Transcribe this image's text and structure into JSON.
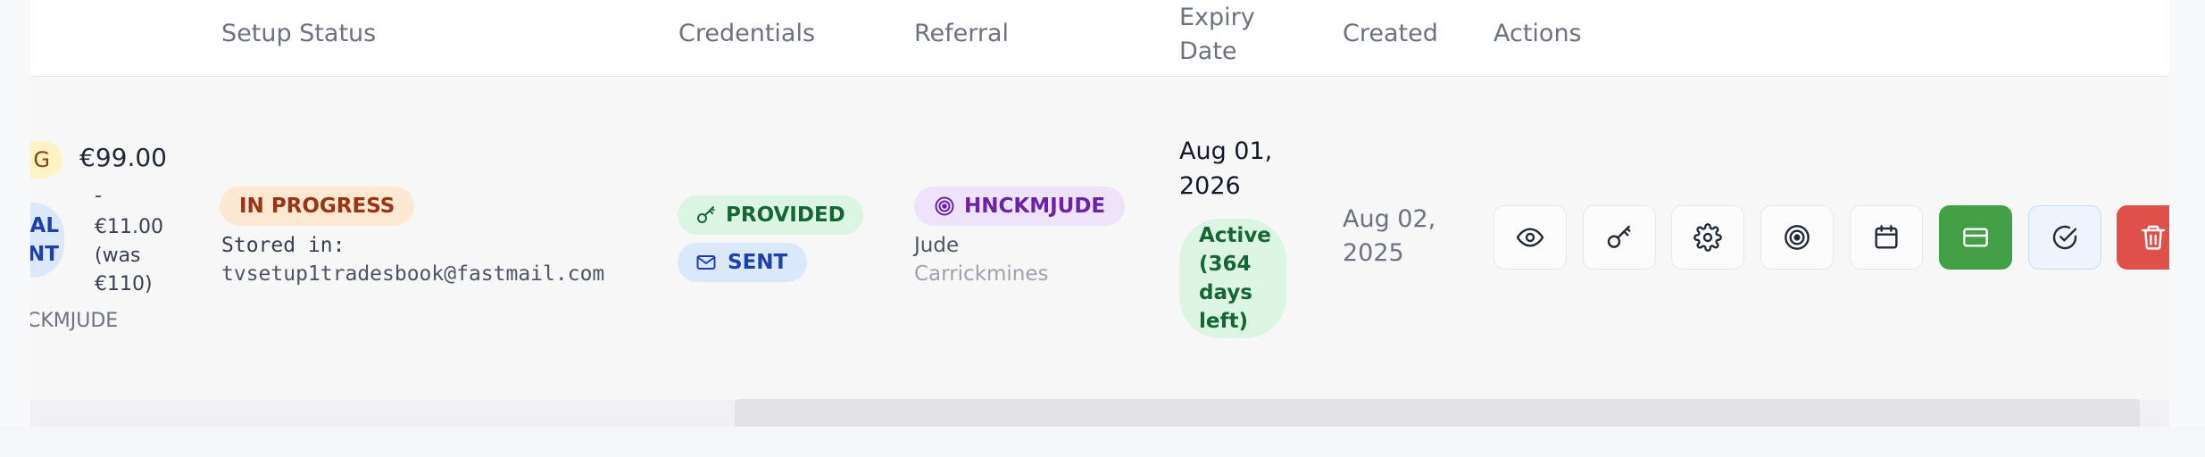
{
  "columns": {
    "setup_status": "Setup Status",
    "credentials": "Credentials",
    "referral": "Referral",
    "expiry_line1": "Expiry",
    "expiry_line2": "Date",
    "created": "Created",
    "actions": "Actions"
  },
  "row": {
    "plan_badge_partial": "G",
    "price": "€99.00",
    "type_badge_line1": "AL",
    "type_badge_line2": "NT",
    "discount_line1": "-",
    "discount_line2": "€11.00",
    "discount_line3": "(was",
    "discount_line4": "€110)",
    "referral_code_partial": "CKMJUDE",
    "setup_status_badge": "IN PROGRESS",
    "stored_in_label": "Stored in:",
    "stored_in_email": "tvsetup1tradesbook@fastmail.com",
    "credentials_provided": "PROVIDED",
    "credentials_sent": "SENT",
    "referral_code": "HNCKMJUDE",
    "referrer_first": "Jude",
    "referrer_last": "Carrickmines",
    "expiry_line1": "Aug 01,",
    "expiry_line2": "2026",
    "expiry_status_line1": "Active",
    "expiry_status_line2": "(364",
    "expiry_status_line3": "days",
    "expiry_status_line4": "left)",
    "created_line1": "Aug 02,",
    "created_line2": "2025"
  },
  "actions": [
    {
      "name": "view",
      "icon": "eye-icon"
    },
    {
      "name": "credentials",
      "icon": "key-icon"
    },
    {
      "name": "settings",
      "icon": "gear-icon"
    },
    {
      "name": "referral",
      "icon": "target-icon"
    },
    {
      "name": "schedule",
      "icon": "calendar-icon"
    },
    {
      "name": "payment",
      "icon": "credit-card-icon"
    },
    {
      "name": "complete",
      "icon": "check-circle-icon"
    },
    {
      "name": "delete",
      "icon": "trash-icon"
    }
  ],
  "colors": {
    "in_progress_bg": "#fde8d4",
    "in_progress_text": "#9a3412",
    "provided_bg": "#dcf5e3",
    "provided_text": "#166534",
    "sent_bg": "#dbe7fb",
    "sent_text": "#1e40af",
    "referral_bg": "#efe3fb",
    "referral_text": "#6b21a8",
    "active_bg": "#dcf5e3",
    "active_text": "#166534",
    "payment_btn": "#43a047",
    "delete_btn": "#e0504a",
    "complete_btn_bg": "#eef4fd"
  }
}
